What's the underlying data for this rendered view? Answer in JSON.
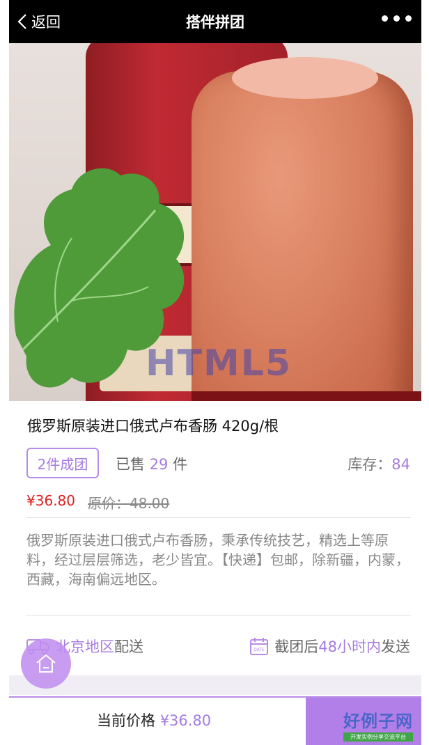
{
  "header": {
    "back_label": "返回",
    "title": "搭伴拼团"
  },
  "carousel": {
    "watermark_text": "HTML5",
    "slide_count": 11,
    "active_index": 1
  },
  "product": {
    "name": "俄罗斯原装进口俄式卢布香肠 420g/根",
    "group_tag": "2件成团",
    "sold_prefix": "已售",
    "sold_count": "29",
    "sold_unit": "件",
    "stock_label": "库存：",
    "stock_value": "84",
    "price": "¥36.80",
    "original_price": "原价：48.00",
    "description": "俄罗斯原装进口俄式卢布香肠，秉承传统技艺，精选上等原料，经过层层筛选，老少皆宜。【快递】包邮，除新疆，内蒙，西藏，海南偏远地区。"
  },
  "shipping": {
    "region_highlight": "北京地区",
    "region_suffix": "配送",
    "calendar_badge": "DATE",
    "delivery_prefix": "截团后",
    "delivery_highlight": "48小时内",
    "delivery_suffix": "发送"
  },
  "bottom_bar": {
    "current_price_label": "当前价格",
    "current_price_value": "¥36.80"
  },
  "brand": {
    "name": "好例子网",
    "slogan": "开发实例分享交流平台"
  },
  "colors": {
    "accent": "#b27fe8",
    "price_red": "#e02020",
    "header_bg": "#000000"
  }
}
